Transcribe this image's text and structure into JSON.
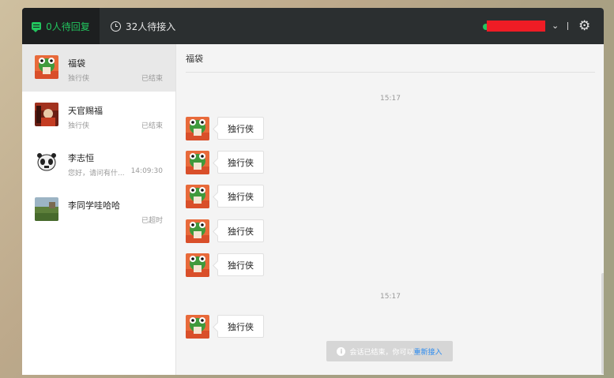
{
  "header": {
    "tab_active_label": "0人待回复",
    "tab_waiting_label": "32人待接入",
    "status_color": "#22c55e",
    "accent_color": "#22c55e",
    "settings_icon": "gear-icon",
    "dropdown_icon": "chevron-down-icon"
  },
  "sidebar": {
    "items": [
      {
        "name": "福袋",
        "sub": "独行侠",
        "meta": "已结束",
        "avatar": "frog-avatar"
      },
      {
        "name": "天官赐福",
        "sub": "独行侠",
        "meta": "已结束",
        "avatar": "photo-avatar"
      },
      {
        "name": "李志恒",
        "sub": "您好，请问有什...",
        "meta": "14:09:30",
        "avatar": "panda-avatar"
      },
      {
        "name": "李同学哇哈哈",
        "sub": "",
        "meta": "已超时",
        "avatar": "landscape-avatar"
      }
    ]
  },
  "chat": {
    "title": "福袋",
    "timestamps": [
      "15:17",
      "15:17"
    ],
    "messages": [
      "独行侠",
      "独行侠",
      "独行侠",
      "独行侠",
      "独行侠",
      "独行侠"
    ],
    "notice": {
      "text": "会话已结束，你可以",
      "link": "重新接入"
    }
  }
}
